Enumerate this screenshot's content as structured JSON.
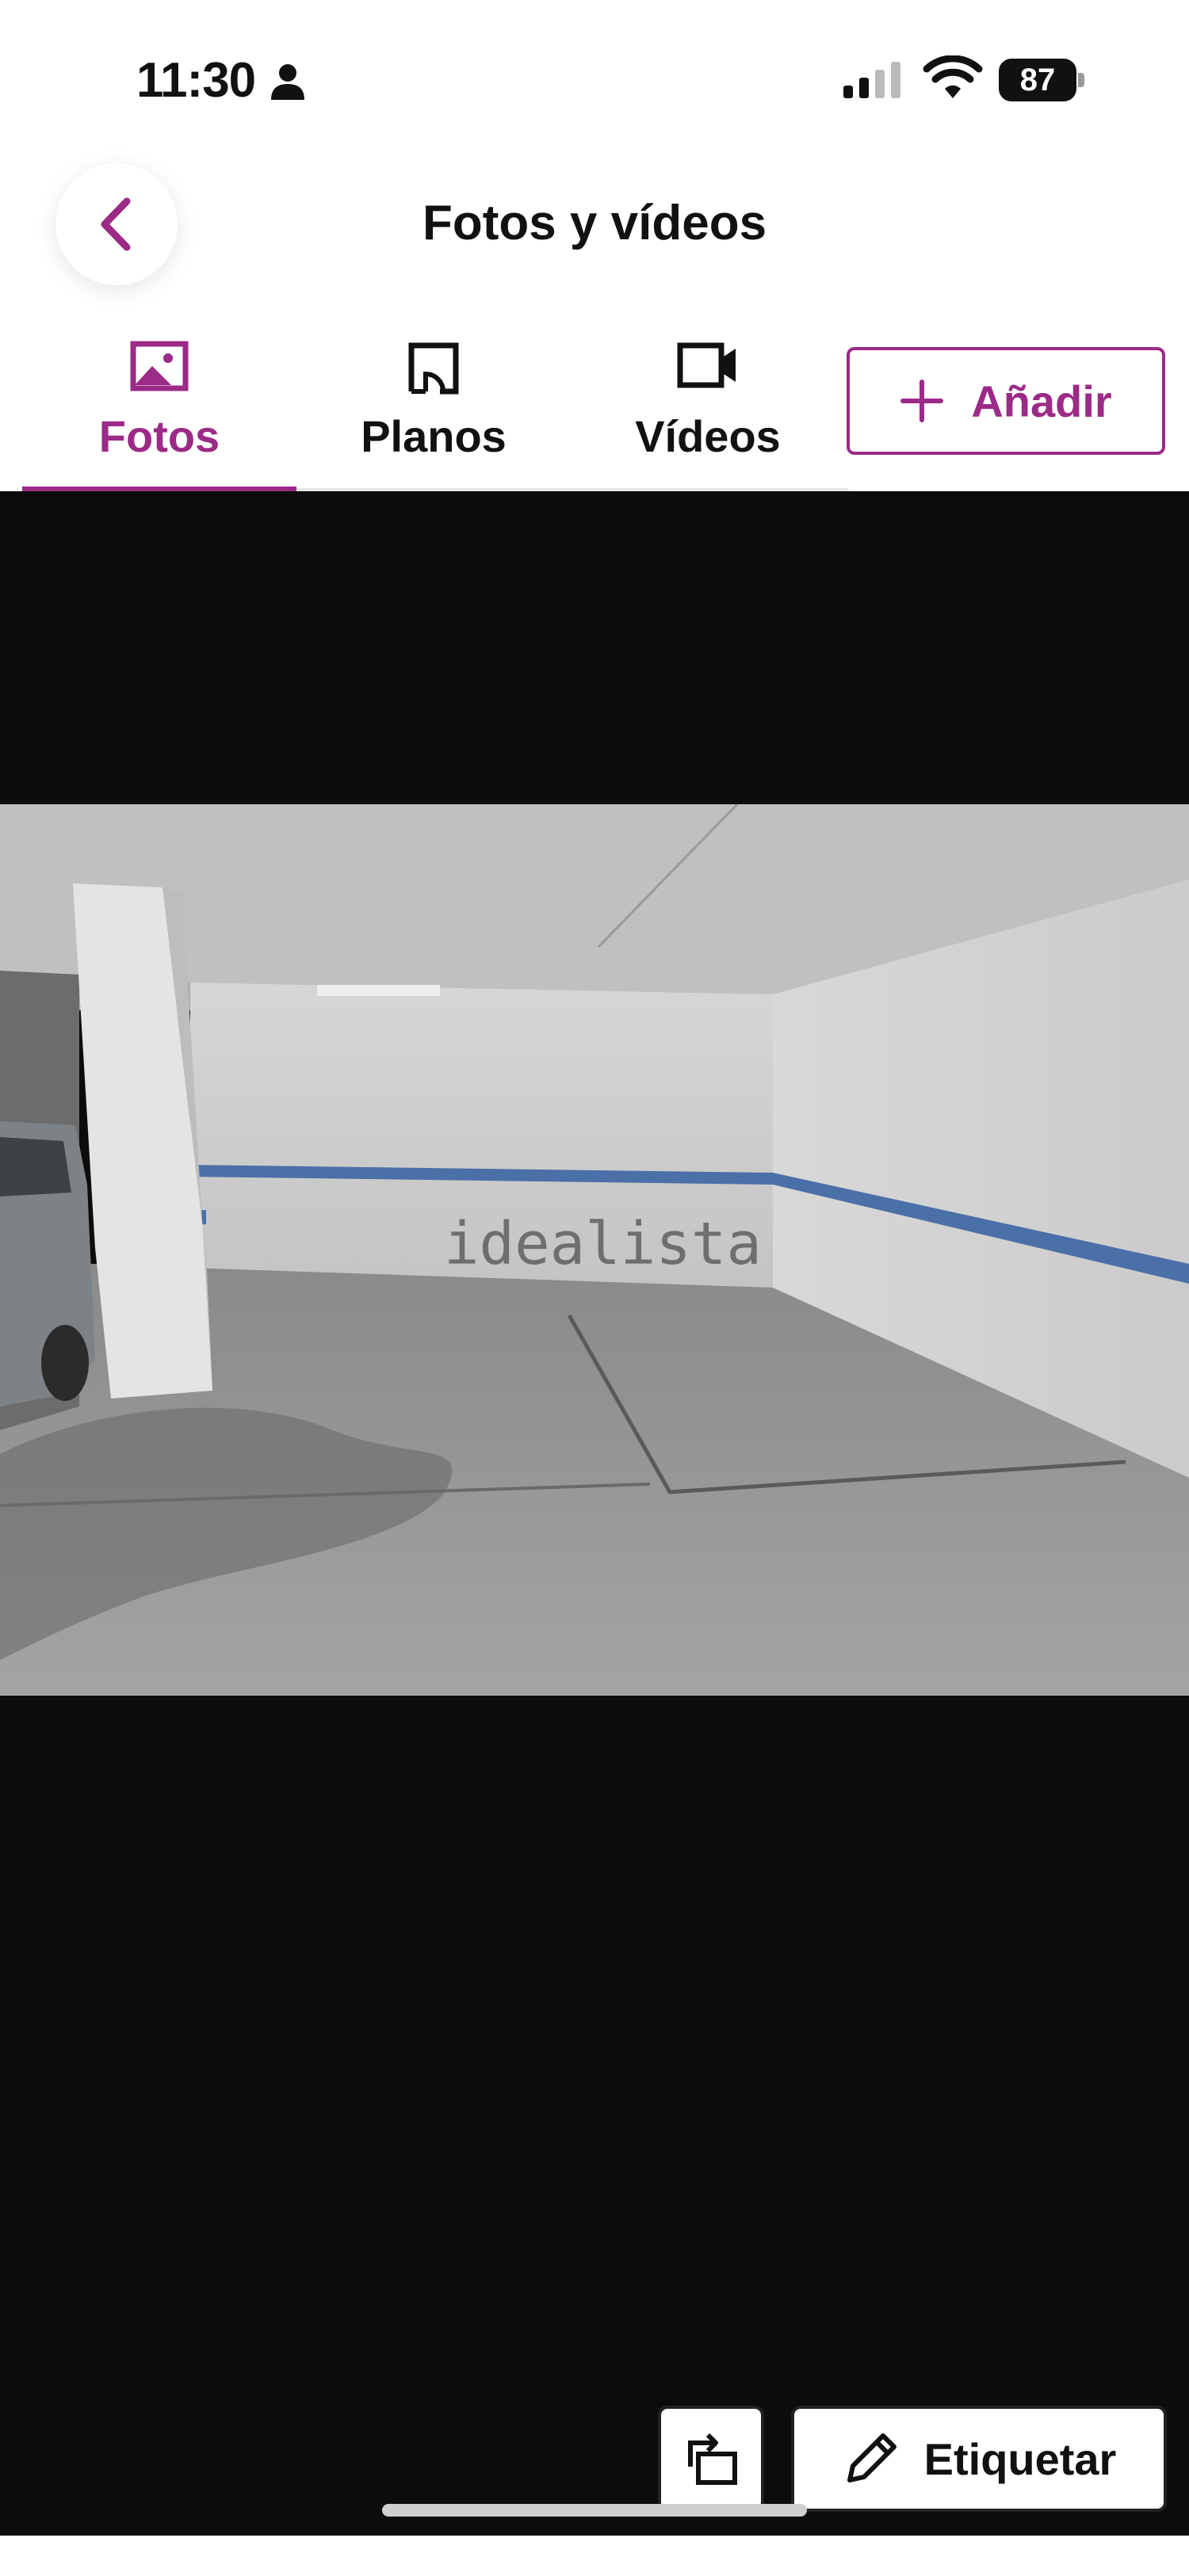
{
  "status_bar": {
    "time": "11:30",
    "battery": "87"
  },
  "header": {
    "title": "Fotos y vídeos"
  },
  "tabs": [
    {
      "label": "Fotos",
      "icon": "image-icon",
      "active": true
    },
    {
      "label": "Planos",
      "icon": "floorplan-icon",
      "active": false
    },
    {
      "label": "Vídeos",
      "icon": "video-camera-icon",
      "active": false
    }
  ],
  "actions": {
    "add_label": "Añadir",
    "tag_label": "Etiquetar"
  },
  "photo": {
    "watermark": "idealista"
  },
  "colors": {
    "accent": "#9c2a87",
    "viewer_background": "#0c0c0c"
  }
}
